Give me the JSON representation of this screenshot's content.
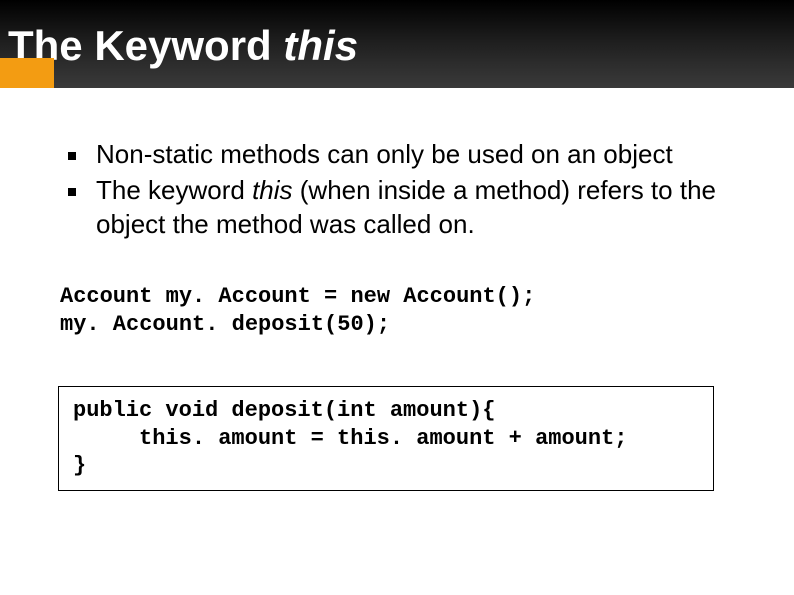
{
  "header": {
    "title_prefix": "The Keyword ",
    "title_italic": "this"
  },
  "bullets": {
    "item1": "Non-static methods can only be used on an object",
    "item2_prefix": "The keyword ",
    "item2_italic": "this",
    "item2_suffix": " (when inside a method) refers to the object the method was called on."
  },
  "code1": "Account my. Account = new Account();\nmy. Account. deposit(50);",
  "code2": "public void deposit(int amount){\n     this. amount = this. amount + amount;\n}"
}
